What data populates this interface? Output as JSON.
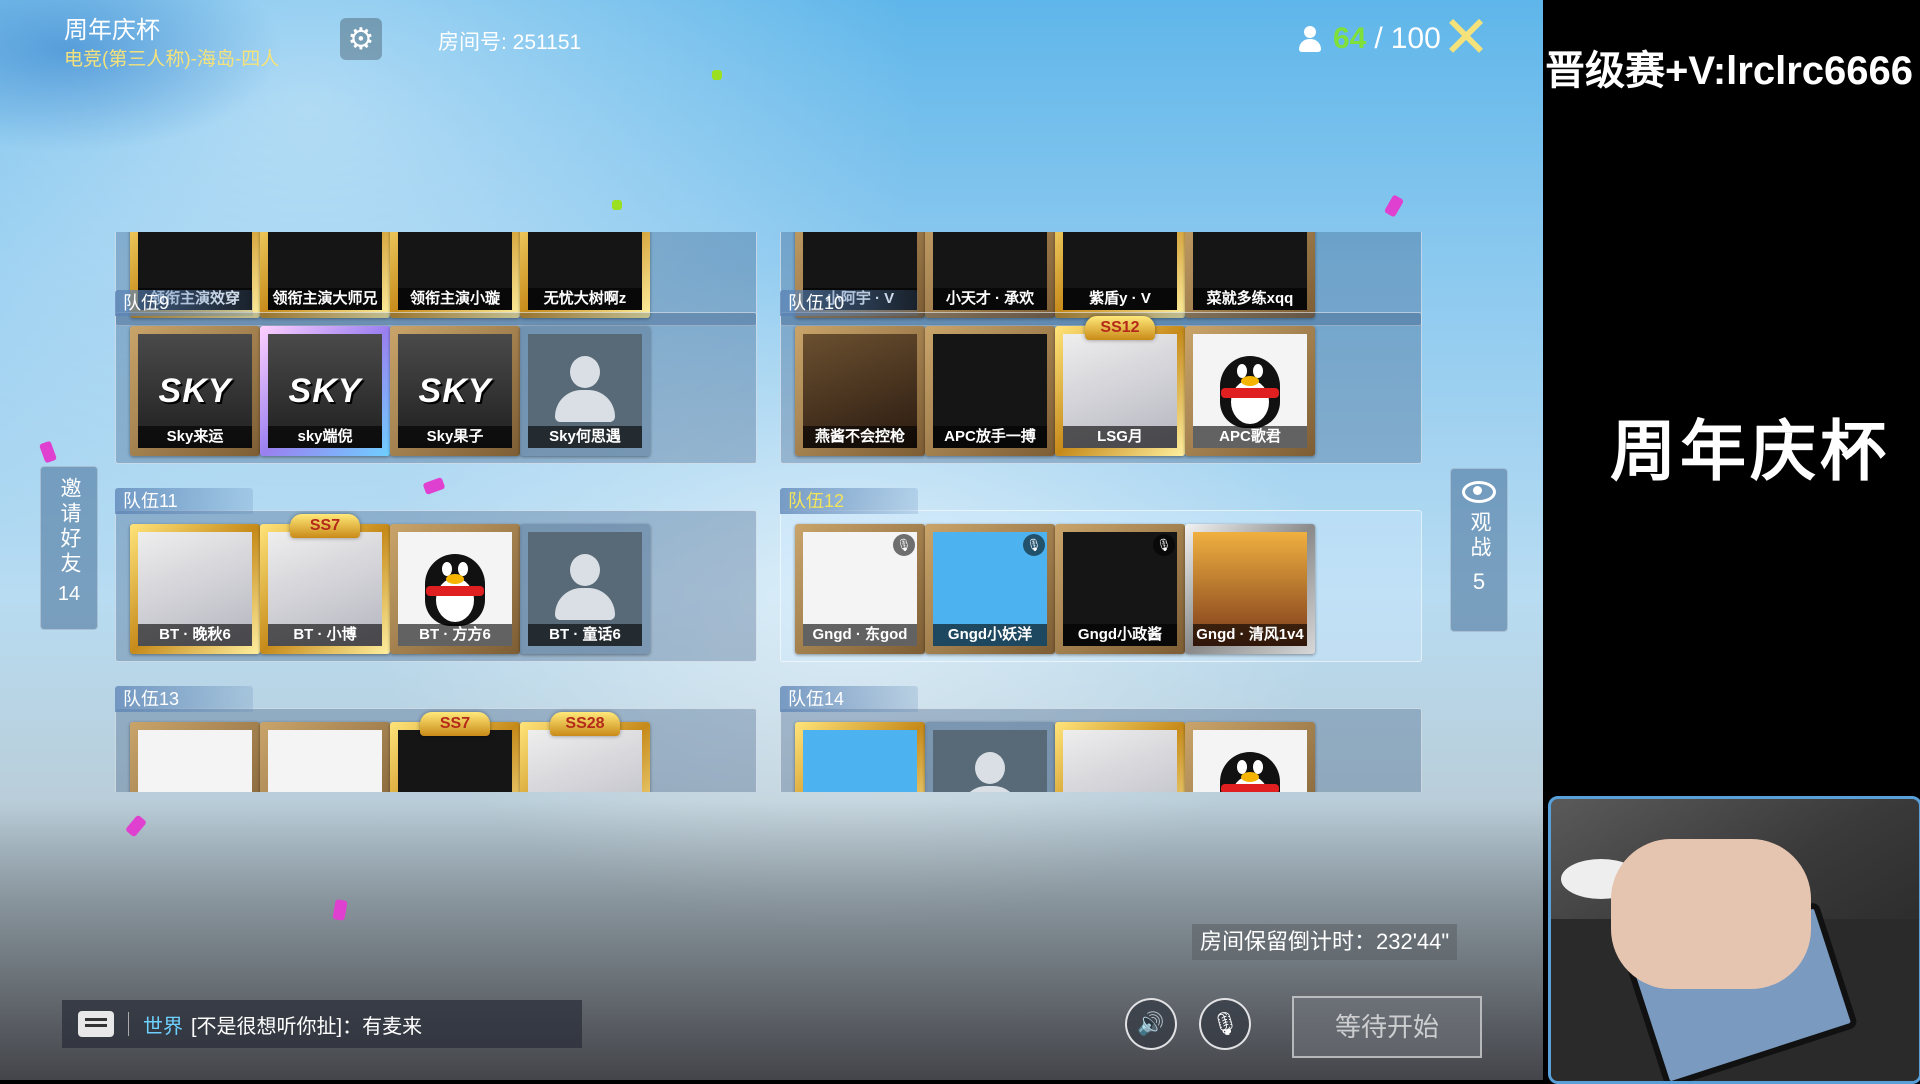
{
  "header": {
    "title": "周年庆杯",
    "mode": "电竞(第三人称)-海岛-四人",
    "room_id": "房间号: 251151",
    "player_count": "64",
    "player_sep": "/",
    "player_max": "100"
  },
  "teams": [
    {
      "label": "",
      "players": [
        {
          "name": "领衔主演效穿",
          "frame": "gold",
          "avatar": "dark"
        },
        {
          "name": "领衔主演大师兄",
          "frame": "gold",
          "avatar": "dark"
        },
        {
          "name": "领衔主演小璇",
          "frame": "gold",
          "avatar": "dark"
        },
        {
          "name": "无忧大树啊z",
          "frame": "gold",
          "avatar": "dark"
        }
      ]
    },
    {
      "label": "",
      "players": [
        {
          "name": "小阿宇 · V",
          "frame": "brown",
          "avatar": "dark"
        },
        {
          "name": "小天才 · 承欢",
          "frame": "brown",
          "avatar": "dark"
        },
        {
          "name": "紫盾y · V",
          "frame": "gold",
          "avatar": "dark"
        },
        {
          "name": "菜就多练xqq",
          "frame": "brown",
          "avatar": "dark"
        }
      ]
    },
    {
      "label": "队伍9",
      "players": [
        {
          "name": "Sky来运",
          "frame": "brown",
          "avatar": "sky"
        },
        {
          "name": "sky端倪",
          "frame": "purple",
          "avatar": "sky"
        },
        {
          "name": "Sky果子",
          "frame": "brown",
          "avatar": "sky"
        },
        {
          "name": "Sky何思遇",
          "frame": "plain",
          "avatar": "grey"
        }
      ]
    },
    {
      "label": "队伍10",
      "players": [
        {
          "name": "燕酱不会控枪",
          "frame": "brown",
          "avatar": "photo1"
        },
        {
          "name": "APC放手一搏",
          "frame": "brown",
          "avatar": "dark"
        },
        {
          "name": "LSG月",
          "frame": "gold",
          "avatar": "anime",
          "badge": "SS12"
        },
        {
          "name": "APC歌君",
          "frame": "brown",
          "avatar": "penguin"
        }
      ]
    },
    {
      "label": "队伍11",
      "players": [
        {
          "name": "BT · 晚秋6",
          "frame": "gold",
          "avatar": "anime"
        },
        {
          "name": "BT · 小博",
          "frame": "gold",
          "avatar": "anime",
          "badge": "SS7"
        },
        {
          "name": "BT · 方方6",
          "frame": "brown",
          "avatar": "penguin"
        },
        {
          "name": "BT · 童话6",
          "frame": "plain",
          "avatar": "grey"
        }
      ]
    },
    {
      "label": "队伍12",
      "players": [
        {
          "name": "Gngd · 东god",
          "frame": "brown",
          "avatar": "white",
          "mic": true
        },
        {
          "name": "Gngd小妖洋",
          "frame": "brown",
          "avatar": "cartoon",
          "mic": true
        },
        {
          "name": "Gngd小政酱",
          "frame": "brown",
          "avatar": "dark",
          "mic": true
        },
        {
          "name": "Gngd · 清风1v4",
          "frame": "silver",
          "avatar": "sunset"
        }
      ]
    },
    {
      "label": "队伍13",
      "players": [
        {
          "name": "",
          "frame": "brown",
          "avatar": "white"
        },
        {
          "name": "",
          "frame": "brown",
          "avatar": "white"
        },
        {
          "name": "",
          "frame": "gold",
          "avatar": "dark",
          "badge": "SS7"
        },
        {
          "name": "",
          "frame": "gold",
          "avatar": "anime",
          "badge": "SS28"
        }
      ]
    },
    {
      "label": "队伍14",
      "players": [
        {
          "name": "",
          "frame": "gold",
          "avatar": "cartoon"
        },
        {
          "name": "",
          "frame": "plain",
          "avatar": "grey"
        },
        {
          "name": "",
          "frame": "gold",
          "avatar": "anime"
        },
        {
          "name": "",
          "frame": "brown",
          "avatar": "penguin"
        }
      ]
    }
  ],
  "invite": {
    "label": "邀请好友",
    "count": "14"
  },
  "spectate": {
    "label": "观战",
    "count": "5"
  },
  "countdown": "房间保留倒计时：232'44\"",
  "chat": {
    "channel": "世界",
    "message": "[不是很想听你扯]：有麦来"
  },
  "wait_button": "等待开始",
  "overlay": {
    "banner": "晋级赛+V:lrclrc6666",
    "title": "周年庆杯"
  },
  "colors": {
    "accent_green": "#7fe03a",
    "gold": "#f6e27a",
    "channel_blue": "#6ed0ff"
  }
}
